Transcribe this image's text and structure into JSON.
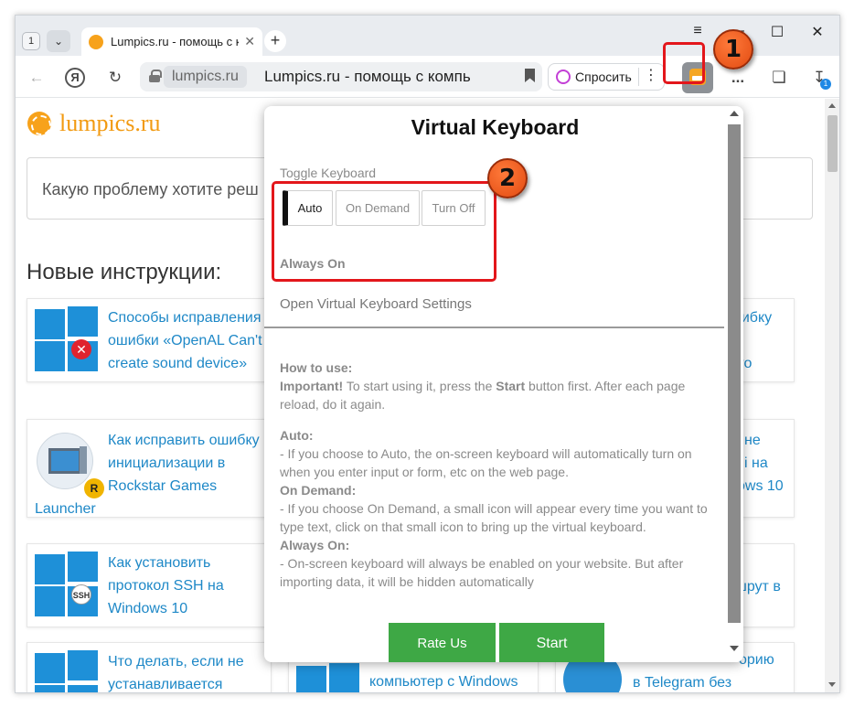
{
  "tabbar": {
    "tab_count": "1",
    "tab_title": "Lumpics.ru - помощь с к",
    "window_controls": [
      "≡",
      "—",
      "☐",
      "✕"
    ]
  },
  "toolbar": {
    "domain": "lumpics.ru",
    "page_title": "Lumpics.ru - помощь с компь",
    "ask_label": "Спросить",
    "downloads_badge": "1",
    "more_label": "..."
  },
  "annotations": {
    "step1": "1",
    "step2": "2",
    "highlight_color": "#e3161b"
  },
  "site": {
    "logo": "lumpics.ru",
    "search_placeholder": "Какую проблему хотите реш",
    "section_title": "Новые инструкции:",
    "cards": [
      {
        "text": "Способы исправления ошибки «OpenAL Can't create sound device»"
      },
      {
        "text": "Как исправить ошибку инициализации в Rockstar Games"
      },
      {
        "text": "Launcher"
      },
      {
        "text": "Как установить протокол SSH на Windows 10"
      },
      {
        "text": "Что делать, если не устанавливается"
      },
      {
        "text": "компьютер с Windows"
      }
    ],
    "right_fragments": [
      "шибку",
      "го",
      "не",
      "і на",
      "ows 10",
      "шрут в",
      "орию",
      "в Telegram без"
    ]
  },
  "popup": {
    "title": "Virtual Keyboard",
    "toggle_label": "Toggle Keyboard",
    "modes": [
      "Auto",
      "On Demand",
      "Turn Off"
    ],
    "active_mode": "Auto",
    "mode_status": "Always On",
    "settings_link": "Open Virtual Keyboard Settings",
    "help": {
      "how_to_use": "How to use:",
      "important_label": "Important!",
      "important_text_1": " To start using it, press the ",
      "start_word": "Start",
      "important_text_2": " button first. After each page reload, do it again.",
      "auto_label": "Auto:",
      "auto_text": "- If you choose to Auto, the on-screen keyboard will automatically turn on when you enter input or form, etc on the web page.",
      "ondemand_label": "On Demand:",
      "ondemand_text": "- If you choose On Demand, a small icon will appear every time you want to type text, click on that small icon to bring up the virtual keyboard.",
      "alwayson_label": "Always On:",
      "alwayson_text": "- On-screen keyboard will always be enabled on your website. But after importing data, it will be hidden automatically"
    },
    "rate_button": "Rate Us",
    "start_button": "Start",
    "accent_color": "#3ea845"
  }
}
